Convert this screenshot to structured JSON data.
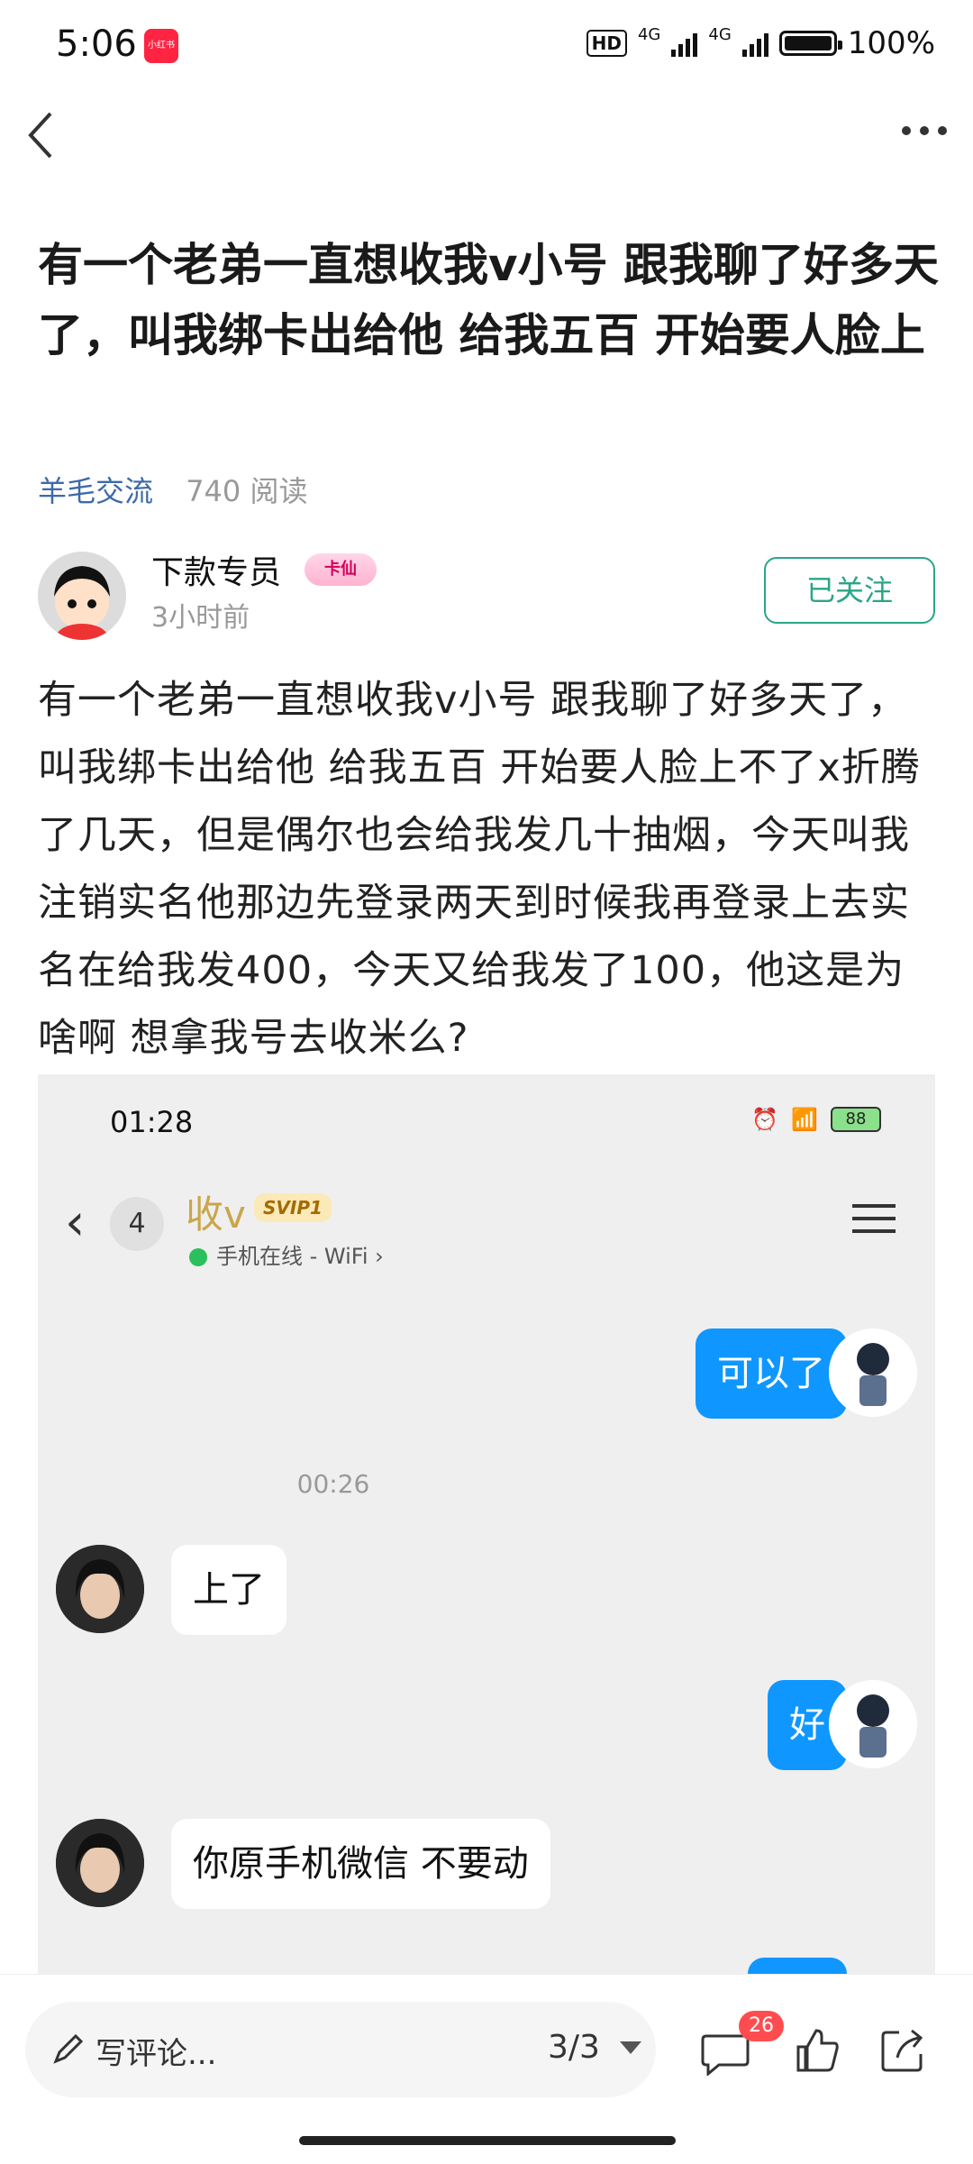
{
  "status_bar": {
    "time": "5:06",
    "app_badge": "小红书",
    "hd": "HD",
    "net1": "4G",
    "net2": "4G",
    "battery": "100%"
  },
  "post": {
    "title": "有一个老弟一直想收我v小号 跟我聊了好多天了，叫我绑卡出给他 给我五百 开始要人脸上",
    "topic": "羊毛交流",
    "reads": "740 阅读",
    "author": "下款专员",
    "author_badge": "卡仙",
    "time": "3小时前",
    "follow_label": "已关注",
    "body": "有一个老弟一直想收我v小号 跟我聊了好多天了，叫我绑卡出给他 给我五百 开始要人脸上不了x折腾了几天，但是偶尔也会给我发几十抽烟，今天叫我注销实名他那边先登录两天到时候我再登录上去实名在给我发400，今天又给我发了100，他这是为啥啊 想拿我号去收米么?"
  },
  "screenshot": {
    "time": "01:28",
    "battery": "88",
    "unread": "4",
    "contact_name": "收v",
    "vip": "SVIP1",
    "online_status": "手机在线 - WiFi",
    "chevron": "›",
    "messages": [
      {
        "from": "me",
        "text": "可以了"
      },
      {
        "from": "time",
        "text": "00:26"
      },
      {
        "from": "them",
        "text": "上了"
      },
      {
        "from": "me",
        "text": "好"
      },
      {
        "from": "them",
        "text": "你原手机微信  不要动"
      }
    ]
  },
  "bottom_bar": {
    "comment_placeholder": "写评论...",
    "page_indicator": "3/3",
    "comment_count": "26"
  }
}
